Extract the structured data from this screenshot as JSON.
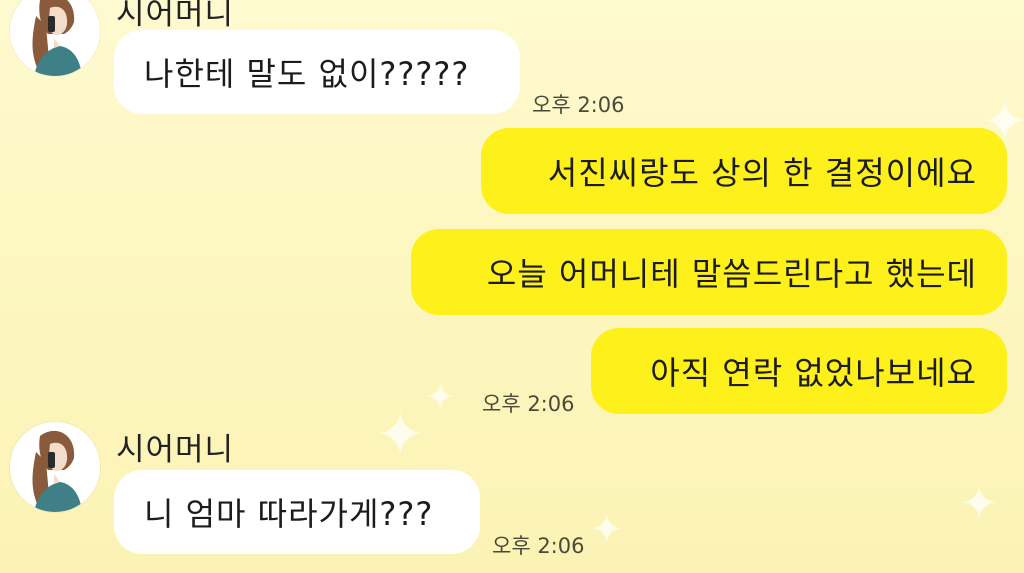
{
  "colors": {
    "background": "#fdf7c2",
    "incoming_bubble": "#ffffff",
    "outgoing_bubble": "#fef01b",
    "timestamp": "#4a4a3a"
  },
  "messages": [
    {
      "sender": "시어머니",
      "direction": "incoming",
      "text": "나한테 말도 없이?????",
      "time": "오후 2:06"
    },
    {
      "direction": "outgoing",
      "text": "서진씨랑도 상의 한 결정이에요"
    },
    {
      "direction": "outgoing",
      "text": "오늘 어머니테 말씀드린다고 했는데"
    },
    {
      "direction": "outgoing",
      "text": "아직 연락 없었나보네요",
      "time": "오후 2:06"
    },
    {
      "sender": "시어머니",
      "direction": "incoming",
      "text": "니 엄마 따라가게???",
      "time": "오후 2:06"
    }
  ],
  "icons": {
    "avatar": "woman-on-phone-avatar-icon",
    "sparkle": "sparkle-icon"
  }
}
